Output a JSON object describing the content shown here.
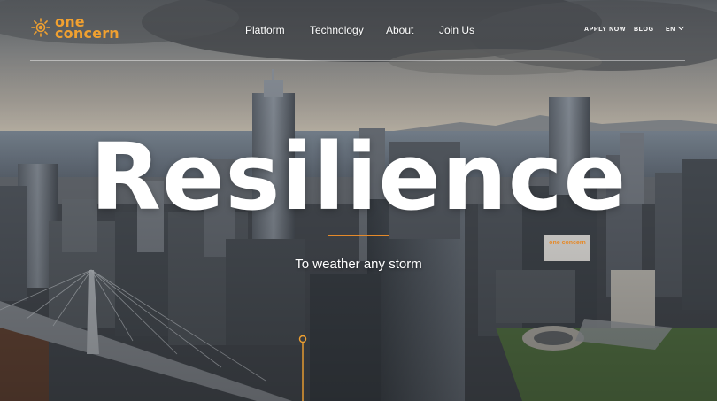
{
  "brand": {
    "line1": "one",
    "line2": "concern",
    "color": "#f0a030"
  },
  "nav": {
    "items": [
      {
        "label": "Platform"
      },
      {
        "label": "Technology"
      },
      {
        "label": "About"
      },
      {
        "label": "Join Us"
      }
    ]
  },
  "utility": {
    "apply": "APPLY NOW",
    "blog": "BLOG",
    "language": "EN"
  },
  "hero": {
    "title": "Resilience",
    "subtitle": "To weather any storm",
    "accent_color": "#e58a2a"
  },
  "billboard": {
    "line1": "one",
    "line2": "concern"
  },
  "icons": [
    "sun-logo-icon",
    "chevron-down-icon",
    "scroll-indicator-icon"
  ]
}
